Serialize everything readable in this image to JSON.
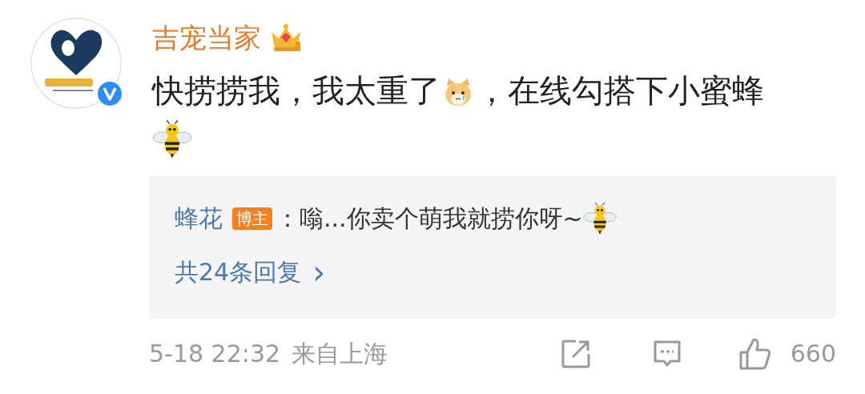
{
  "comment": {
    "author": "吉宠当家",
    "crown": true,
    "verified": true,
    "content": [
      {
        "kind": "text",
        "text": "快捞捞我，我太重了"
      },
      {
        "kind": "cat_emoji"
      },
      {
        "kind": "text",
        "text": "，在线勾搭下小蜜蜂"
      },
      {
        "kind": "bee_emoji"
      }
    ],
    "reply": {
      "author": "蜂花",
      "badge": "博主",
      "content": [
        {
          "kind": "text",
          "text": "：嗡...你卖个萌我就捞你呀~"
        },
        {
          "kind": "bee_emoji"
        }
      ],
      "more": "共24条回复",
      "more_arrow": "›"
    },
    "footer": {
      "time": "5-18 22:32",
      "location": "来自上海",
      "likes": "660"
    }
  }
}
